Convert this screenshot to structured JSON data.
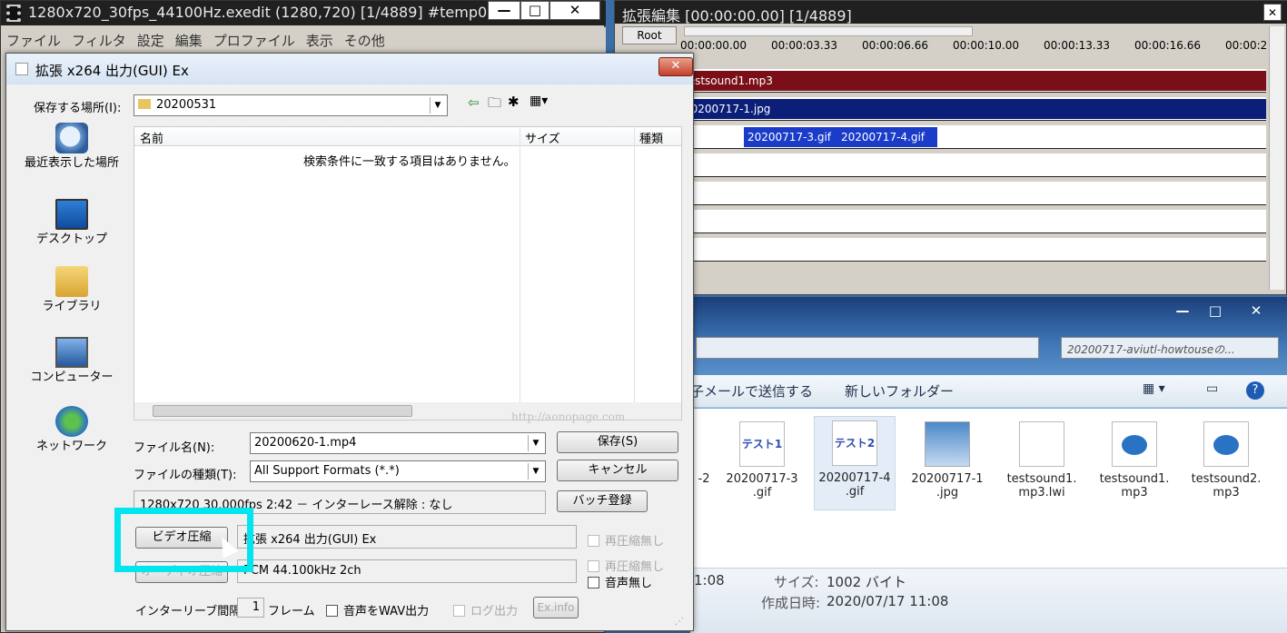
{
  "main_window": {
    "title": "1280x720_30fps_44100Hz.exedit (1280,720)  [1/4889]  #temp0",
    "menu": [
      "ファイル",
      "フィルタ",
      "設定",
      "編集",
      "プロファイル",
      "表示",
      "その他"
    ],
    "minimize": "—",
    "maximize": "□",
    "close": "✕"
  },
  "timeline": {
    "title": "拡張編集 [00:00:00.00] [1/4889]",
    "root_label": "Root",
    "close": "✕",
    "ticks": [
      "00:00:00.00",
      "00:00:03.33",
      "00:00:06.66",
      "00:00:10.00",
      "00:00:13.33",
      "00:00:16.66",
      "00:00:2"
    ],
    "clips": [
      {
        "label": "testsound1.mp3",
        "color": "#7a0f18"
      },
      {
        "label": "20200717-1.jpg",
        "color": "#0b1e78"
      },
      {
        "label": "20200717-3.gif",
        "color": "#1a3cc9"
      },
      {
        "label": "20200717-4.gif",
        "color": "#1a3cc9"
      }
    ]
  },
  "explorer": {
    "search_placeholder": "20200717-aviutl-howtouseの...",
    "toolbar": {
      "email": "子メールで送信する",
      "new_folder": "新しいフォルダー"
    },
    "files": [
      {
        "name": "-2",
        "icon": "gif"
      },
      {
        "name": "20200717-3\n.gif",
        "icon": "gif",
        "thumb": "テスト1"
      },
      {
        "name": "20200717-4\n.gif",
        "icon": "gif",
        "thumb": "テスト2"
      },
      {
        "name": "20200717-1\n.jpg",
        "icon": "jpg"
      },
      {
        "name": "testsound1.\nmp3.lwi",
        "icon": "doc"
      },
      {
        "name": "testsound1.\nmp3",
        "icon": "mp3"
      },
      {
        "name": "testsound2.\nmp3",
        "icon": "mp3"
      }
    ],
    "details": {
      "time_partial": "1:08",
      "size_label": "サイズ:",
      "size_value": "1002 バイト",
      "created_label": "作成日時:",
      "created_value": "2020/07/17 11:08"
    },
    "minimize": "—",
    "maximize": "□",
    "close": "✕"
  },
  "dialog": {
    "title": "拡張 x264 出力(GUI) Ex",
    "close": "✕",
    "save_in_label": "保存する場所(I):",
    "save_in_value": "20200531",
    "places": [
      "最近表示した場所",
      "デスクトップ",
      "ライブラリ",
      "コンピューター",
      "ネットワーク"
    ],
    "columns": {
      "name": "名前",
      "size": "サイズ",
      "type": "種類"
    },
    "empty_message": "検索条件に一致する項目はありません。",
    "watermark": "http://aonopage.com",
    "filename_label": "ファイル名(N):",
    "filename_value": "20200620-1.mp4",
    "filetype_label": "ファイルの種類(T):",
    "filetype_value": "All Support Formats (*.*)",
    "save_button": "保存(S)",
    "cancel_button": "キャンセル",
    "batch_button": "バッチ登録",
    "info_text": "1280x720  30.000fps  2:42  －  インターレース解除 : なし",
    "video_button": "ビデオ圧縮",
    "video_codec": "拡張 x264 出力(GUI) Ex",
    "audio_button": "オーディオ圧縮",
    "audio_codec": "PCM 44.100kHz 2ch",
    "recompress_video": "再圧縮無し",
    "recompress_audio": "再圧縮無し",
    "no_audio": "音声無し",
    "interleave_label": "インターリーブ間隔",
    "interleave_value": "1",
    "frames_label": "フレーム",
    "wav_output": "音声をWAV出力",
    "log_output": "ログ出力",
    "exinfo_button": "Ex.info"
  }
}
